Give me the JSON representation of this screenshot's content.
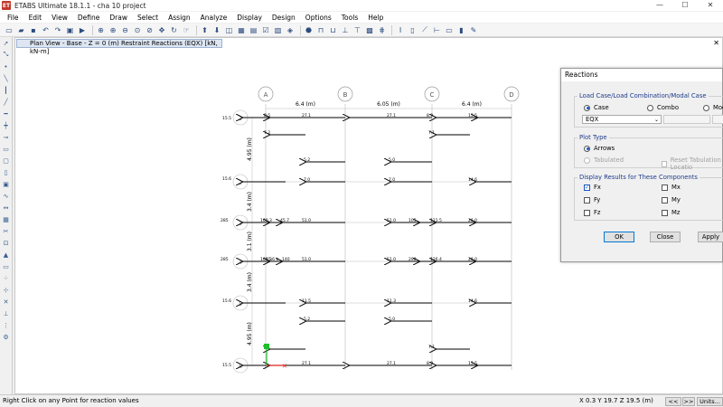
{
  "window": {
    "title": "ETABS Ultimate 18.1.1 - cha 10 project",
    "app_icon_text": "ET",
    "controls": [
      "—",
      "☐",
      "✕"
    ]
  },
  "menu": [
    "File",
    "Edit",
    "View",
    "Define",
    "Draw",
    "Select",
    "Assign",
    "Analyze",
    "Display",
    "Design",
    "Options",
    "Tools",
    "Help"
  ],
  "view": {
    "tab_title": "Plan View - Base - Z = 0 (m)   Restraint Reactions   (EQX)  [kN, kN-m]",
    "close": "✕"
  },
  "grid": {
    "columns": [
      "A",
      "B",
      "C",
      "D"
    ],
    "column_spacings": [
      "6.4 (m)",
      "6.05 (m)",
      "6.4 (m)"
    ],
    "rows": [
      "1",
      "2",
      "3",
      "4",
      "5",
      "6"
    ],
    "row_spacings": [
      "4.95 (m)",
      "3.4 (m)",
      "3.1 (m)",
      "3.4 (m)",
      "4.95 (m)"
    ]
  },
  "reactions": {
    "row1": {
      "edge": "15.5",
      "a": "8.5",
      "b": "27.1",
      "c1": "27.1",
      "c2": "8.9",
      "d": "15.5"
    },
    "sub1": {
      "a": "7.2",
      "c": "7.1"
    },
    "mid1": {
      "b": "5.2",
      "c": "5.0"
    },
    "row2": {
      "edge": "15.6",
      "b": "7.0",
      "c": "7.0",
      "d": "14.6"
    },
    "row3": {
      "edge": "285",
      "a1": "100.3",
      "a2": "45.7",
      "b": "51.0",
      "c1": "51.0",
      "c2": "105",
      "c3": "121.5",
      "d": "26.0"
    },
    "row4": {
      "edge": "285",
      "a1": "100.3",
      "a2": "15.6 k",
      "b2": "140",
      "b": "51.0",
      "c1": "51.0",
      "c2": "290",
      "c3": "126.4",
      "d": "26.0"
    },
    "row5": {
      "edge": "15.6",
      "b": "11.5",
      "c": "11.3",
      "d": "14.6"
    },
    "mid2": {
      "b": "5.2",
      "c": "5.0"
    },
    "sub2": {
      "c": "7.1"
    },
    "row6": {
      "edge": "15.5",
      "b": "27.1",
      "c1": "27.1",
      "c2": "8.0",
      "d": "15.5"
    }
  },
  "dialog": {
    "title": "Reactions",
    "load_group": "Load Case/Load Combination/Modal Case",
    "case_label": "Case",
    "combo_label": "Combo",
    "mode_label": "Mode",
    "case_value": "EQX",
    "plot_group": "Plot Type",
    "arrows_label": "Arrows",
    "tabulated_label": "Tabulated",
    "reset_label": "Reset Tabulation Locatio",
    "components_group": "Display Results for These Components",
    "fx": "Fx",
    "fy": "Fy",
    "fz": "Fz",
    "mx": "Mx",
    "my": "My",
    "mz": "Mz",
    "ok": "OK",
    "close": "Close",
    "apply": "Apply"
  },
  "status": {
    "hint": "Right Click on any Point for reaction values",
    "coords": "X 0.3  Y 19.7  Z 19.5 (m)",
    "prev": "<<",
    "next": ">>",
    "units": "Units..."
  }
}
